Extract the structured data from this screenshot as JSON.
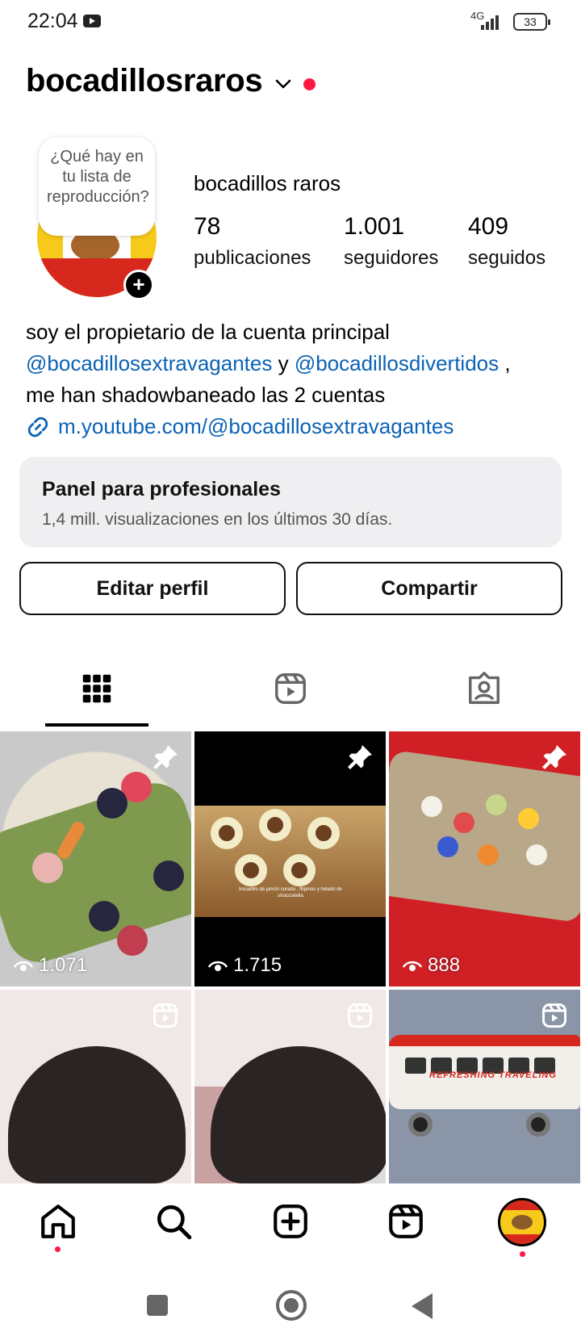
{
  "status_bar": {
    "time": "22:04",
    "network": "4G",
    "battery": "33"
  },
  "header": {
    "username": "bocadillosraros"
  },
  "profile": {
    "note": "¿Qué hay en tu lista de reproducción?",
    "full_name": "bocadillos raros",
    "stats": [
      {
        "count": "78",
        "label": "publicaciones"
      },
      {
        "count": "1.001",
        "label": "seguidores"
      },
      {
        "count": "409",
        "label": "seguidos"
      }
    ]
  },
  "bio": {
    "line1": "soy el propietario de la cuenta principal",
    "mention1": "@bocadillosextravagantes",
    "connector": " y ",
    "mention2": "@bocadillosdivertidos",
    "comma": " ,",
    "line3": "me han shadowbaneado las 2 cuentas",
    "link": "m.youtube.com/@bocadillosextravagantes"
  },
  "dashboard": {
    "title": "Panel para profesionales",
    "subtitle": "1,4 mill. visualizaciones en los últimos 30 días."
  },
  "buttons": {
    "edit": "Editar perfil",
    "share": "Compartir"
  },
  "grid": {
    "posts": [
      {
        "views": "1.071",
        "badge": "pin-icon"
      },
      {
        "views": "1.715",
        "badge": "pin-icon",
        "caption": "bocadillo de jamón curado , filipinos y helado de stracciatella"
      },
      {
        "views": "888",
        "badge": "pin-icon"
      },
      {
        "badge": "reel-icon"
      },
      {
        "badge": "reel-icon"
      },
      {
        "badge": "reel-icon",
        "bus_text": "REFRESHING TRAVELING"
      }
    ]
  },
  "colors": {
    "accent_link": "#0b62b5",
    "notification": "#ff1744",
    "dashboard_bg": "#efeff1"
  }
}
